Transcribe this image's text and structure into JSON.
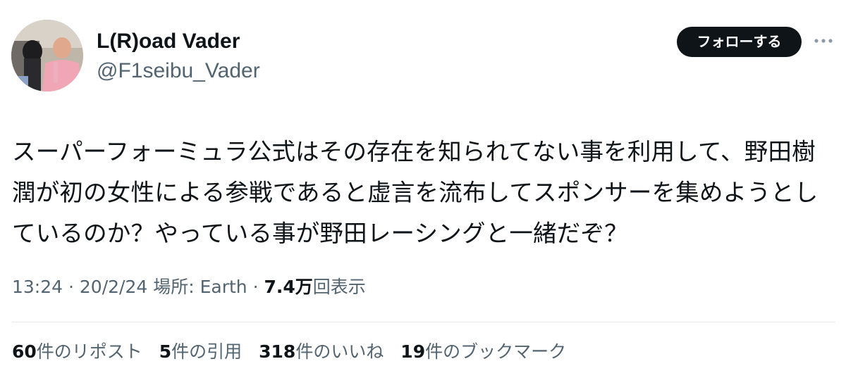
{
  "author": {
    "display_name": "L(R)oad Vader",
    "handle": "@F1seibu_Vader"
  },
  "follow_button_label": "フォローする",
  "more_icon": "ellipsis-icon",
  "tweet": {
    "lines": [
      "スーパーフォーミュラ公式はその存在を知られてない事を利用して、野田樹",
      "潤が初の女性による参戦であると虚言を流布してスポンサーを集めようとし",
      "ているのか？やっている事が野田レーシングと一緒だぞ？"
    ]
  },
  "meta": {
    "time": "13:24",
    "separator1": " · ",
    "date": "20/2/24",
    "location_label": " 場所: ",
    "location": "Earth",
    "separator2": " · ",
    "views_count": "7.4万",
    "views_label": "回表示"
  },
  "stats": {
    "reposts": {
      "count": "60",
      "label": "件のリポスト"
    },
    "quotes": {
      "count": "5",
      "label": "件の引用"
    },
    "likes": {
      "count": "318",
      "label": "件のいいね"
    },
    "bookmarks": {
      "count": "19",
      "label": "件のブックマーク"
    }
  },
  "colors": {
    "text_primary": "#0f1419",
    "text_secondary": "#536471",
    "follow_button_bg": "#0f1419",
    "divider": "#e6e9eb"
  }
}
